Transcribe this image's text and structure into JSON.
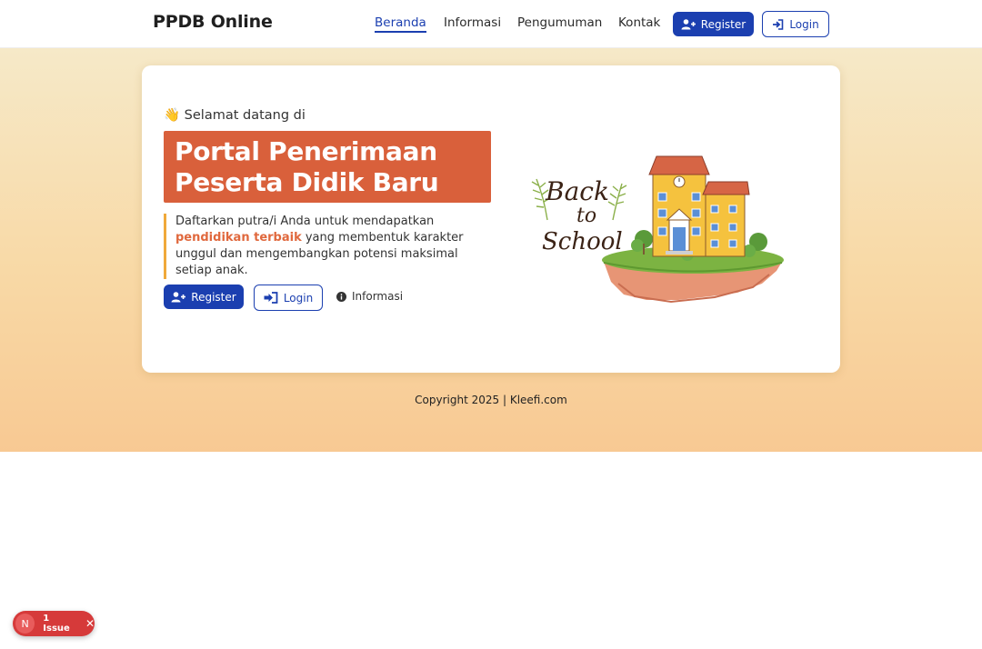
{
  "nav": {
    "brand": "PPDB Online",
    "links": [
      "Beranda",
      "Informasi",
      "Pengumuman",
      "Kontak"
    ],
    "register_label": "Register",
    "login_label": "Login"
  },
  "hero": {
    "welcome": "👋 Selamat datang di",
    "headline": [
      "Portal Penerimaan",
      "Peserta Didik Baru"
    ],
    "description": {
      "before": "Daftarkan putra/i Anda untuk mendapatkan ",
      "highlight": "pendidikan terbaik",
      "after": " yang membentuk karakter unggul dan mengembangkan potensi maksimal setiap anak."
    },
    "register_label": "Register",
    "login_label": "Login",
    "info_label": "Informasi",
    "illustration_text": [
      "Back",
      "to",
      "School"
    ]
  },
  "footer": {
    "copyright": "Copyright 2025 | Kleefi.com"
  },
  "dev_overlay": {
    "badge_letter": "N",
    "issues_label": "1 Issue",
    "close_symbol": "✕"
  },
  "colors": {
    "primary": "#1b3fb0",
    "accent": "#d9603b",
    "highlight": "#e0683d",
    "border_accent": "#f0a93a",
    "issue": "#d63a3a"
  },
  "icons": [
    "user-plus-icon",
    "sign-in-icon",
    "info-circle-icon",
    "close-icon"
  ]
}
